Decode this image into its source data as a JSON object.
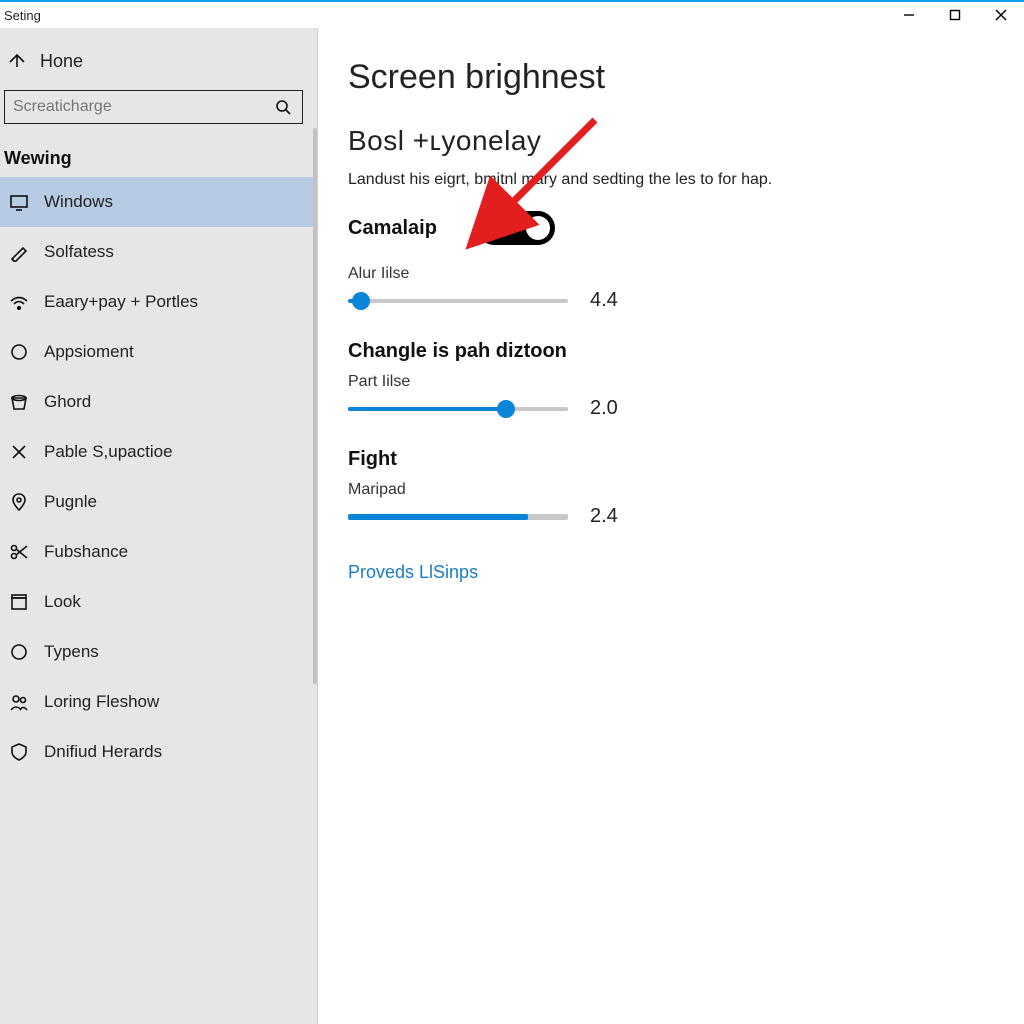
{
  "window": {
    "title": "Seting"
  },
  "sidebar": {
    "home_label": "Hone",
    "search_placeholder": "Screaticharge",
    "category": "Wewing",
    "items": [
      {
        "label": "Windows",
        "icon": "display"
      },
      {
        "label": "Solfatess",
        "icon": "pen"
      },
      {
        "label": "Eaary+pay + Portles",
        "icon": "wifi"
      },
      {
        "label": "Appsioment",
        "icon": "circle"
      },
      {
        "label": "Ghord",
        "icon": "bucket"
      },
      {
        "label": "Pable S,upactioe",
        "icon": "cross"
      },
      {
        "label": "Pugnle",
        "icon": "pin"
      },
      {
        "label": "Fubshance",
        "icon": "scissors"
      },
      {
        "label": "Look",
        "icon": "box"
      },
      {
        "label": "Typens",
        "icon": "circle"
      },
      {
        "label": "Loring Fleshow",
        "icon": "people"
      },
      {
        "label": "Dnifiud Herards",
        "icon": "shield"
      }
    ],
    "selected_index": 0
  },
  "main": {
    "page_title": "Screen brighnest",
    "subheading": "Bosl +ʟyonelay",
    "description": "Landust his eigrt, bmitnl mary and sedting the les to for hap.",
    "toggle": {
      "label": "Camalaip",
      "state": "on"
    },
    "sliders": [
      {
        "group_head": "",
        "label": "Alur Iilse",
        "value_text": "4.4",
        "fill_pct": 6,
        "thumb": true
      },
      {
        "group_head": "Changle is pah diztoon",
        "label": "Part Iilse",
        "value_text": "2.0",
        "fill_pct": 72,
        "thumb": true
      },
      {
        "group_head": "Fight",
        "label": "Maripad",
        "value_text": "2.4",
        "fill_pct": 82,
        "thumb": false
      }
    ],
    "link": "Proveds LlSinps"
  },
  "colors": {
    "accent": "#0a85d8",
    "selection": "#b7cbe4",
    "arrow": "#e21e1e"
  }
}
